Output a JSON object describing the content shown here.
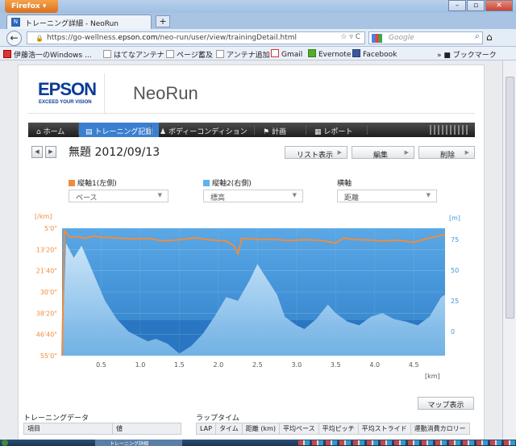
{
  "browser": {
    "menu_button": "Firefox",
    "tab_title": "トレーニング詳細 - NeoRun",
    "new_tab": "+",
    "url_prefix": "https://go-wellness.",
    "url_domain": "epson.com",
    "url_path": "/neo-run/user/view/trainingDetail.html",
    "search_placeholder": "Google",
    "bookmarks": [
      "伊藤浩一のWindows ...",
      "はてなアンテナ",
      "ページ蓄及",
      "アンテナ追加",
      "Gmail",
      "Evernote",
      "Facebook"
    ],
    "bookmarks_menu": "ブックマーク"
  },
  "site": {
    "brand": "EPSON",
    "brand_tagline": "EXCEED YOUR VISION",
    "product": "NeoRun"
  },
  "menu": {
    "items": [
      "ホーム",
      "トレーニング記録",
      "ボディーコンディション",
      "計画",
      "レポート"
    ],
    "active_index": 1
  },
  "detail": {
    "title": "無題 2012/09/13",
    "buttons": [
      "リスト表示",
      "編集",
      "削除"
    ]
  },
  "axes": {
    "left_label": "縦軸1(左側)",
    "left_value": "ペース",
    "right_label": "縦軸2(右側)",
    "right_value": "標高",
    "x_label": "横軸",
    "x_value": "距離",
    "left_color": "#f08c3c",
    "right_color": "#5cb4ec"
  },
  "chart_data": {
    "type": "line",
    "y_left_unit": "[/km]",
    "y_right_unit": "[m]",
    "x_unit": "[km]",
    "x_ticks": [
      "0.5",
      "1.0",
      "1.5",
      "2.0",
      "2.5",
      "3.0",
      "3.5",
      "4.0",
      "4.5"
    ],
    "y_left_ticks": [
      "5'0\"",
      "13'20\"",
      "21'40\"",
      "30'0\"",
      "38'20\"",
      "46'40\"",
      "55'0\""
    ],
    "y_right_ticks": [
      "75",
      "50",
      "25",
      "0"
    ],
    "xlim": [
      0,
      4.9
    ],
    "series": [
      {
        "name": "ペース",
        "axis": "left",
        "unit": "min/km",
        "x": [
          0,
          0.03,
          0.1,
          0.2,
          0.3,
          0.4,
          0.5,
          0.7,
          0.9,
          1.1,
          1.3,
          1.5,
          1.7,
          1.9,
          2.1,
          2.2,
          2.25,
          2.3,
          2.5,
          2.7,
          2.9,
          3.1,
          3.3,
          3.5,
          3.6,
          3.7,
          3.9,
          4.1,
          4.3,
          4.5,
          4.7,
          4.9
        ],
        "y": [
          55,
          6,
          8.5,
          8.3,
          9,
          8,
          8.5,
          8.8,
          9.2,
          9,
          10,
          9.5,
          8.8,
          9.6,
          10,
          12,
          15,
          9,
          9.4,
          9.3,
          9.8,
          9.5,
          9.7,
          10.8,
          8.8,
          9.4,
          9.6,
          10,
          9.7,
          10.5,
          8.8,
          7.5
        ]
      },
      {
        "name": "標高",
        "axis": "right",
        "unit": "m",
        "x": [
          0,
          0.05,
          0.15,
          0.25,
          0.35,
          0.45,
          0.55,
          0.7,
          0.85,
          1.0,
          1.1,
          1.2,
          1.35,
          1.5,
          1.65,
          1.8,
          1.95,
          2.1,
          2.25,
          2.4,
          2.5,
          2.6,
          2.75,
          2.85,
          3.0,
          3.1,
          3.25,
          3.4,
          3.5,
          3.65,
          3.8,
          3.95,
          4.1,
          4.25,
          4.4,
          4.55,
          4.7,
          4.85,
          4.9
        ],
        "y": [
          -22,
          72,
          60,
          70,
          55,
          40,
          25,
          10,
          0,
          -5,
          -8,
          -6,
          -10,
          -18,
          -12,
          -2,
          12,
          28,
          25,
          42,
          55,
          45,
          30,
          12,
          5,
          2,
          10,
          22,
          15,
          8,
          5,
          12,
          15,
          10,
          8,
          5,
          12,
          28,
          30
        ]
      }
    ]
  },
  "bottom": {
    "map_button": "マップ表示",
    "training_data_title": "トレーニングデータ",
    "training_headers": [
      "項目",
      "値"
    ],
    "lap_title": "ラップタイム",
    "lap_headers": [
      "LAP",
      "タイム",
      "距離 (km)",
      "平均ペース",
      "平均ピッチ",
      "平均ストライド",
      "運動消費カロリー"
    ]
  },
  "taskbar": {
    "active_window": "トレーニング詳細"
  }
}
